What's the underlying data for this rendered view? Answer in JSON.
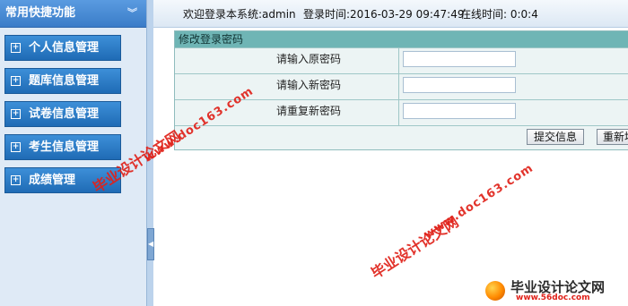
{
  "sidebar": {
    "title": "常用快捷功能",
    "collapse_glyph": "︾",
    "items": [
      {
        "label": "个人信息管理",
        "icon": "plus-box-icon"
      },
      {
        "label": "题库信息管理",
        "icon": "plus-box-icon"
      },
      {
        "label": "试卷信息管理",
        "icon": "plus-box-icon"
      },
      {
        "label": "考生信息管理",
        "icon": "plus-box-icon"
      },
      {
        "label": "成绩管理",
        "icon": "plus-box-icon"
      }
    ],
    "plus_glyph": "⊞"
  },
  "splitter": {
    "handle_glyph": "◀"
  },
  "topbar": {
    "welcome": "欢迎登录本系统:admin",
    "login_time": "登录时间:2016-03-29 09:47:49",
    "online_time": "在线时间: 0:0:4"
  },
  "form": {
    "title": "修改登录密码",
    "rows": [
      {
        "label": "请输入原密码",
        "value": ""
      },
      {
        "label": "请输入新密码",
        "value": ""
      },
      {
        "label": "请重复新密码",
        "value": ""
      }
    ],
    "submit_label": "提交信息",
    "reset_label": "重新填"
  },
  "watermarks": {
    "site_text": "毕业设计论文网",
    "url_text": "www.doc163.com",
    "logo_text": "毕业设计论文网",
    "logo_url": "www.56doc.com"
  },
  "colors": {
    "sidebar_button": "#2a7bc6",
    "panel_header": "#6fb5b5",
    "watermark_red": "#e0221a"
  }
}
